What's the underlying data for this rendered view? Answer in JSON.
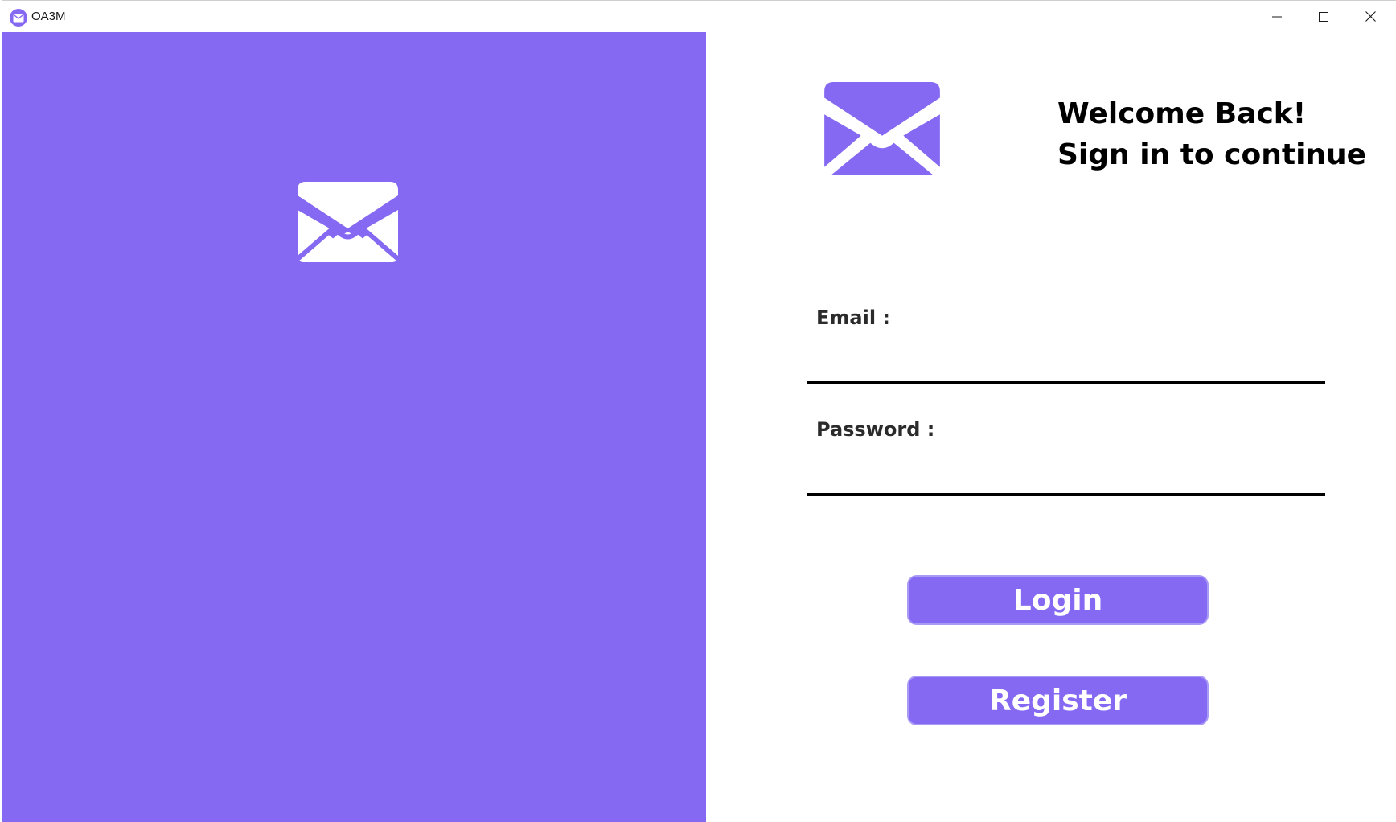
{
  "window": {
    "title": "OA3M",
    "controls": {
      "minimize_icon": "minimize-icon",
      "maximize_icon": "maximize-icon",
      "close_icon": "close-icon"
    }
  },
  "colors": {
    "accent": "#8569f3",
    "background": "#ffffff",
    "text": "#000000"
  },
  "left_panel": {
    "logo_icon": "envelope-icon"
  },
  "right_panel": {
    "logo_icon": "envelope-icon",
    "heading_line1": "Welcome Back!",
    "heading_line2": "Sign in to continue",
    "email": {
      "label": "Email :",
      "value": ""
    },
    "password": {
      "label": "Password :",
      "value": ""
    },
    "login_label": "Login",
    "register_label": "Register"
  }
}
